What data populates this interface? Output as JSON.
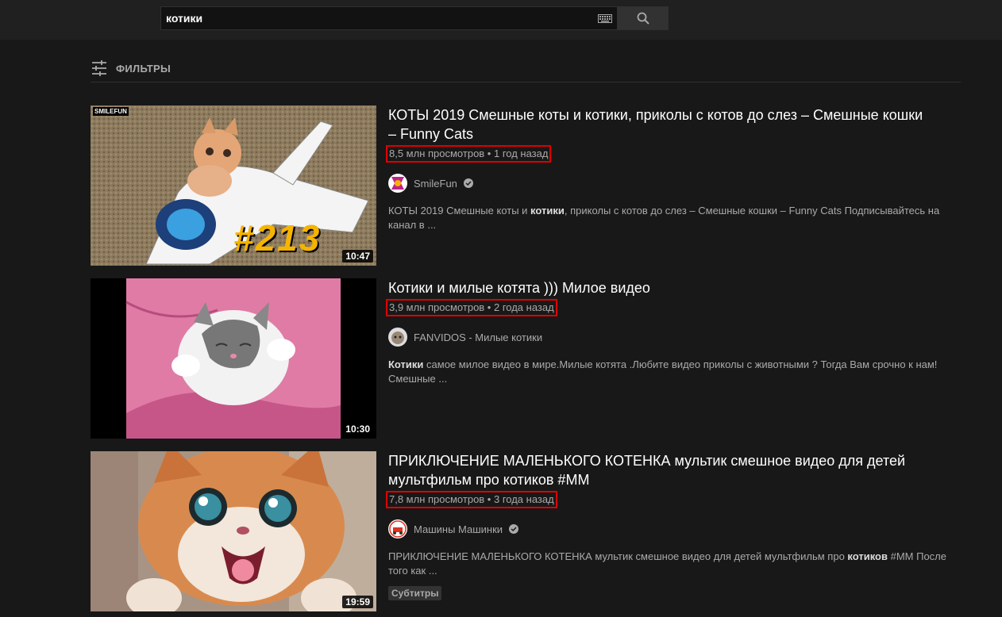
{
  "search": {
    "query": "котики"
  },
  "filters": {
    "label": "ФИЛЬТРЫ"
  },
  "results": [
    {
      "title": "КОТЫ 2019 Смешные коты и котики, приколы с котов до слез – Смешные кошки – Funny Cats",
      "meta": "8,5 млн просмотров • 1 год назад",
      "channel": "SmileFun",
      "verified": true,
      "duration": "10:47",
      "thumb_text": "SMILEFUN",
      "thumb_overlay": "#213",
      "desc_before": "КОТЫ 2019 Смешные коты и ",
      "desc_bold": "котики",
      "desc_after": ", приколы с котов до слез – Смешные кошки – Funny Cats Подписывайтесь на канал в ..."
    },
    {
      "title": "Котики и милые котята ))) Милое видео",
      "meta": "3,9 млн просмотров • 2 года назад",
      "channel": "FANVIDOS - Милые котики",
      "verified": false,
      "duration": "10:30",
      "desc_before": "",
      "desc_bold": "Котики",
      "desc_after": " самое милое видео в мире.Милые котята .Любите видео приколы с животными ? Тогда Вам срочно к нам! Смешные ..."
    },
    {
      "title": "ПРИКЛЮЧЕНИЕ МАЛЕНЬКОГО КОТЕНКА мультик смешное видео для детей мультфильм про котиков #ММ",
      "meta": "7,8 млн просмотров • 3 года назад",
      "channel": "Машины Машинки",
      "verified": true,
      "duration": "19:59",
      "desc_before": "ПРИКЛЮЧЕНИЕ МАЛЕНЬКОГО КОТЕНКА мультик смешное видео для детей мультфильм про ",
      "desc_bold": "котиков",
      "desc_after": " #ММ После того как ...",
      "badge": "Субтитры"
    }
  ],
  "colors": {
    "background": "#181818",
    "topbar": "#202020",
    "highlight": "#e00000"
  }
}
